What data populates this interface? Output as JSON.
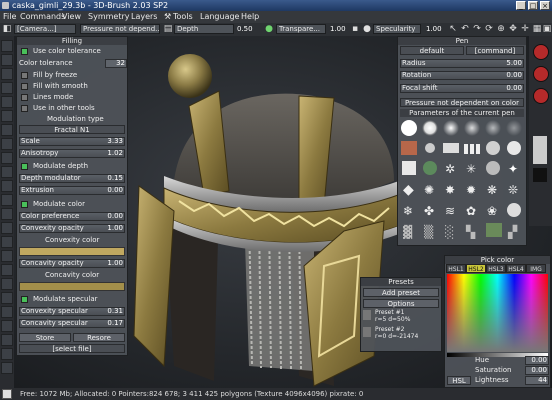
{
  "window": {
    "title": "caska_gimli_29.3b - 3D-Brush 2.03 SP2"
  },
  "menu": [
    "File",
    "Commands",
    "View",
    "Symmetry",
    "Layers",
    "Tools",
    "Language",
    "Help"
  ],
  "toolbar": {
    "camera": "[Camera...]",
    "pressure": "Pressure not depend...",
    "depth_label": "Depth",
    "depth_value": "0.50",
    "transparency_label": "Transpare...",
    "transparency_value": "1.00",
    "specularity_label": "Specularity",
    "specularity_value": "1.00"
  },
  "filling": {
    "header": "Filling",
    "use_color_tolerance": "Use color tolerance",
    "color_tolerance_label": "Color tolerance",
    "color_tolerance_value": "32",
    "fill_by_freeze": "Fill by freeze",
    "fill_with_smooth": "Fill with smooth",
    "lines_mode": "Lines mode",
    "use_in_other_tools": "Use in other tools",
    "modulation_type_label": "Modulation type",
    "modulation_type_value": "Fractal N1",
    "scale_label": "Scale",
    "scale_value": "3.33",
    "anisotropy_label": "Anisotropy",
    "anisotropy_value": "1.02",
    "modulate_depth": "Modulate depth",
    "depth_modulator_label": "Depth modulator",
    "depth_modulator_value": "0.15",
    "extrusion_label": "Extrusion",
    "extrusion_value": "0.00",
    "modulate_color": "Modulate color",
    "color_preference_label": "Color preference",
    "color_preference_value": "0.00",
    "convexity_opacity_label": "Convexity opacity",
    "convexity_opacity_value": "1.00",
    "convexity_color_label": "Convexity color",
    "concavity_opacity_label": "Concavity opacity",
    "concavity_opacity_value": "1.00",
    "concavity_color_label": "Concavity color",
    "modulate_specular": "Modulate specular",
    "convexity_specular_label": "Convexity specular",
    "convexity_specular_value": "0.31",
    "concavity_specular_label": "Concavity specular",
    "concavity_specular_value": "0.17",
    "store_button": "Store",
    "restore_button": "Resore",
    "select_file": "[select file]",
    "convexity_color": "#c0a860",
    "concavity_color": "#a38f4a"
  },
  "pen": {
    "header": "Pen",
    "preset_left": "default",
    "preset_right": "[command]",
    "radius_label": "Radius",
    "radius_value": "5.00",
    "rotation_label": "Rotation",
    "rotation_value": "0.00",
    "focal_shift_label": "Focal shift",
    "focal_shift_value": "0.00",
    "pressure_mode": "Pressure not dependent on color",
    "params_header": "Parameters of the current pen"
  },
  "presets": {
    "header": "Presets",
    "add_preset": "Add preset",
    "options": "Options",
    "preset1_name": "Preset #1",
    "preset1_desc": "r=5 d=50%",
    "preset2_name": "Preset #2",
    "preset2_desc": "r=0 d=-21474"
  },
  "pick_color": {
    "header": "Pick color",
    "tabs": [
      "HSL1",
      "HSL2",
      "HSL3",
      "HSL4",
      "IMG"
    ],
    "active_tab": "HSL2",
    "hue_label": "Hue",
    "hue_value": "0.00",
    "saturation_label": "Saturation",
    "saturation_value": "0.00",
    "lightness_label": "Lightness",
    "lightness_value": "44",
    "hsl_button": "HSL"
  },
  "status": {
    "text": "Free: 1072 Mb; Allocated: 0 Pointers:824 678; 3 411 425 polygons (Texture 4096x4096) pixrate: 0"
  }
}
